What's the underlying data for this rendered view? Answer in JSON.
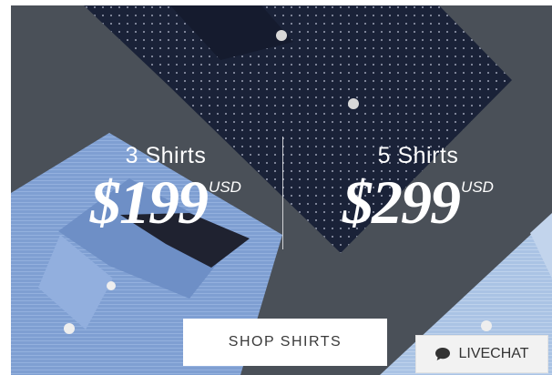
{
  "promo": {
    "offer_3": {
      "quantity": "3 Shirts",
      "price": "$199",
      "currency": "USD"
    },
    "offer_5": {
      "quantity": "5 Shirts",
      "price": "$299",
      "currency": "USD"
    }
  },
  "cta": {
    "label": "SHOP SHIRTS"
  },
  "livechat": {
    "label": "LIVECHAT",
    "icon": "chat-bubble-icon"
  },
  "colors": {
    "background": "#4a5058",
    "navy_shirt": "#1a2238",
    "blue_shirt": "#7e9fd0",
    "light_blue_shirt": "#a9c2e3",
    "button": "#ffffff"
  }
}
